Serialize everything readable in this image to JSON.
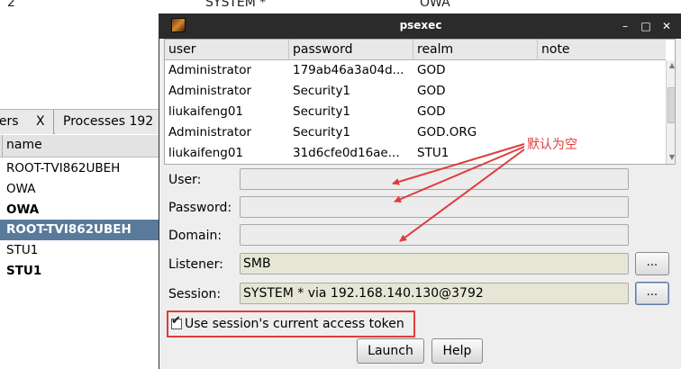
{
  "background": {
    "top_cells": [
      "2",
      "SYSTEM *",
      "OWA"
    ],
    "tabs": [
      {
        "label": "ners",
        "close": "X"
      },
      {
        "label": "Processes 192"
      }
    ],
    "column_header": "name",
    "rows": [
      {
        "label": "ROOT-TVI862UBEH",
        "bold": false,
        "selected": false
      },
      {
        "label": "OWA",
        "bold": false,
        "selected": false
      },
      {
        "label": "OWA",
        "bold": true,
        "selected": false
      },
      {
        "label": "ROOT-TVI862UBEH",
        "bold": true,
        "selected": true
      },
      {
        "label": "STU1",
        "bold": false,
        "selected": false
      },
      {
        "label": "STU1",
        "bold": true,
        "selected": false
      }
    ]
  },
  "dialog": {
    "title": "psexec",
    "window_buttons": {
      "minimize": "–",
      "maximize": "□",
      "close": "✕"
    },
    "table": {
      "columns": [
        "user",
        "password",
        "realm",
        "note"
      ],
      "rows": [
        [
          "Administrator",
          "179ab46a3a04d...",
          "GOD",
          ""
        ],
        [
          "Administrator",
          "Security1",
          "GOD",
          ""
        ],
        [
          "liukaifeng01",
          "Security1",
          "GOD",
          ""
        ],
        [
          "Administrator",
          "Security1",
          "GOD.ORG",
          ""
        ],
        [
          "liukaifeng01",
          "31d6cfe0d16ae...",
          "STU1",
          ""
        ]
      ]
    },
    "form": {
      "user_label": "User:",
      "user_value": "",
      "password_label": "Password:",
      "password_value": "",
      "domain_label": "Domain:",
      "domain_value": "",
      "listener_label": "Listener:",
      "listener_value": "SMB",
      "session_label": "Session:",
      "session_value": "SYSTEM * via  192.168.140.130@3792",
      "browse_label": "...",
      "checkbox_label": "Use session's current access token",
      "checkbox_checked": true
    },
    "buttons": {
      "launch": "Launch",
      "help": "Help"
    }
  },
  "annotation": {
    "text": "默认为空",
    "color": "#e23b3b"
  }
}
